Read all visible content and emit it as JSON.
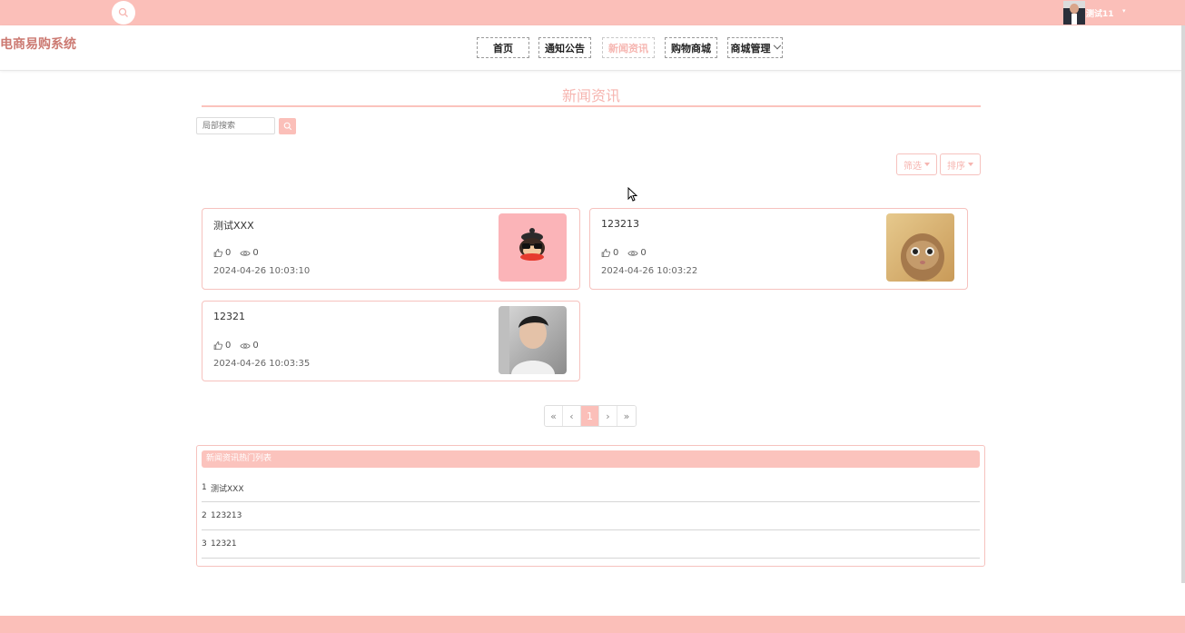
{
  "topbar": {
    "username": "测试11",
    "icons": {
      "search": "search-icon",
      "user_caret": "caret-down-icon"
    }
  },
  "header": {
    "brand": "电商易购系统",
    "nav": [
      {
        "label": "首页"
      },
      {
        "label": "通知公告"
      },
      {
        "label": "新闻资讯",
        "active": true
      },
      {
        "label": "购物商城"
      },
      {
        "label": "商城管理",
        "has_dropdown": true
      }
    ]
  },
  "main": {
    "title": "新闻资讯",
    "search": {
      "placeholder": "局部搜索",
      "value": ""
    },
    "filter_label": "筛选",
    "sort_label": "排序",
    "cards": [
      {
        "title": "测试XXX",
        "likes": "0",
        "views": "0",
        "date": "2024-04-26 10:03:10",
        "thumb": "cartoon-monkey-image"
      },
      {
        "title": "123213",
        "likes": "0",
        "views": "0",
        "date": "2024-04-26 10:03:22",
        "thumb": "cat-photo"
      },
      {
        "title": "12321",
        "likes": "0",
        "views": "0",
        "date": "2024-04-26 10:03:35",
        "thumb": "person-photo"
      }
    ],
    "pagination": {
      "first": "«",
      "prev": "‹",
      "current": "1",
      "next": "›",
      "last": "»"
    }
  },
  "hot_list": {
    "title": "新闻资讯热门列表",
    "items": [
      {
        "rank": "1",
        "title": "测试XXX"
      },
      {
        "rank": "2",
        "title": "123213"
      },
      {
        "rank": "3",
        "title": "12321"
      }
    ]
  },
  "colors": {
    "accent": "#fbbfb9",
    "active_text": "#f6b5b0",
    "brand_text": "#cc7a72"
  }
}
